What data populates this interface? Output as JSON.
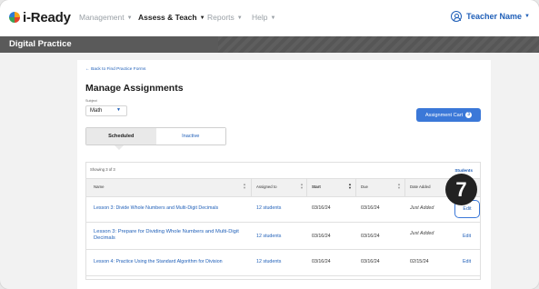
{
  "nav": {
    "brand": "i-Ready",
    "menus": [
      {
        "label": "Management",
        "active": false
      },
      {
        "label": "Assess & Teach",
        "active": true
      },
      {
        "label": "Reports",
        "active": false
      },
      {
        "label": "Help",
        "active": false
      }
    ],
    "user": "Teacher Name"
  },
  "section_title": "Digital Practice",
  "page": {
    "back_link": "← Back to Find Practice Forms",
    "title": "Manage Assignments",
    "subject_label": "Subject",
    "subject_value": "Math",
    "cart_label": "Assignment Cart",
    "cart_count": "3",
    "tabs": [
      {
        "label": "Scheduled",
        "selected": true
      },
      {
        "label": "Inactive",
        "selected": false
      }
    ]
  },
  "table": {
    "showing": "Showing 3 of 3",
    "students_link": "Students",
    "headers": [
      "Name",
      "Assigned to",
      "Start",
      "Due",
      "Date Added",
      ""
    ],
    "rows": [
      {
        "name": "Lesson 3: Divide Whole Numbers and Multi-Digit Decimals",
        "assigned_to": "12 students",
        "start": "03/16/24",
        "due": "03/16/24",
        "date_added": "Just Added",
        "action": "Edit"
      },
      {
        "name": "Lesson 3: Prepare for Dividing Whole Numbers and Multi-Digit Decimals",
        "assigned_to": "12 students",
        "start": "03/16/24",
        "due": "03/16/24",
        "date_added": "Just Added",
        "action": "Edit"
      },
      {
        "name": "Lesson 4: Practice Using the Standard Algorithm for Division",
        "assigned_to": "12 students",
        "start": "03/16/24",
        "due": "03/16/24",
        "date_added": "02/15/24",
        "action": "Edit"
      }
    ]
  },
  "step_badge": "7",
  "colors": {
    "accent": "#3b78d8",
    "link": "#1f5fb8",
    "dark_bar": "#5a5a5a"
  }
}
